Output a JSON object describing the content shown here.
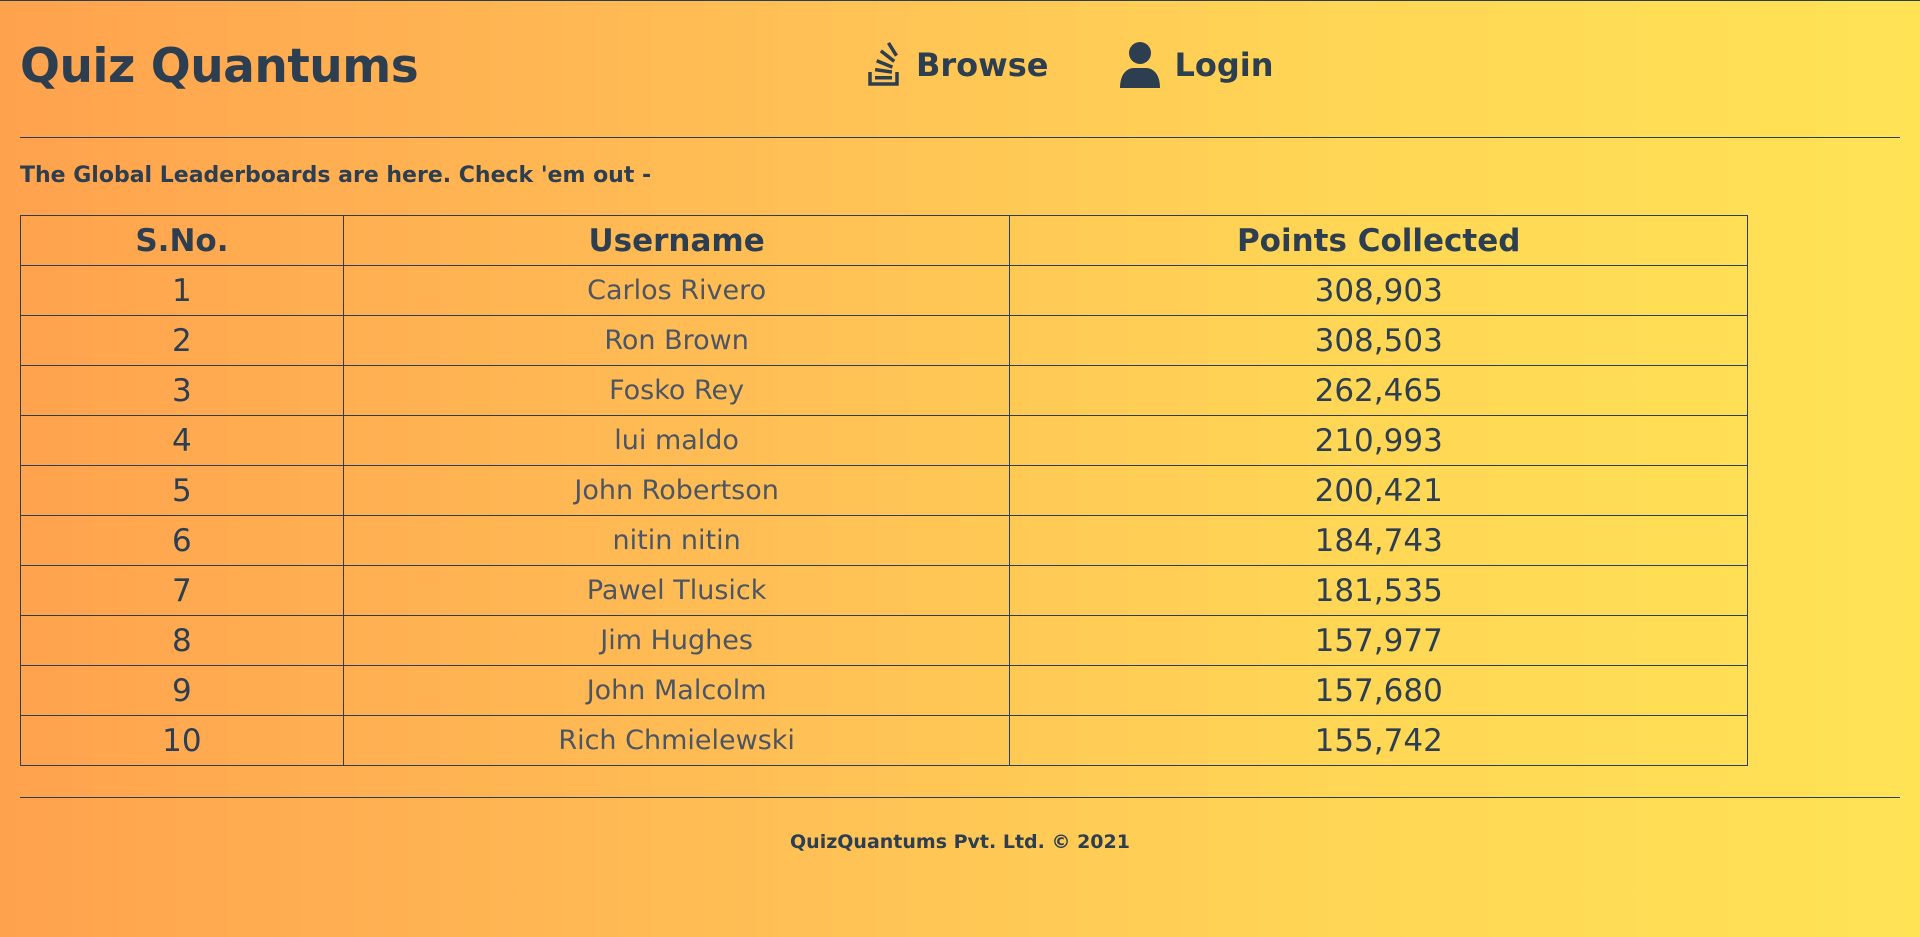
{
  "header": {
    "brand": "Quiz Quantums",
    "nav": {
      "browse_label": "Browse",
      "login_label": "Login"
    }
  },
  "main": {
    "intro": "The Global Leaderboards are here. Check 'em out -",
    "table": {
      "headers": [
        "S.No.",
        "Username",
        "Points Collected"
      ],
      "rows": [
        {
          "sno": "1",
          "username": "Carlos Rivero",
          "points": "308,903"
        },
        {
          "sno": "2",
          "username": "Ron Brown",
          "points": "308,503"
        },
        {
          "sno": "3",
          "username": "Fosko Rey",
          "points": "262,465"
        },
        {
          "sno": "4",
          "username": "lui maldo",
          "points": "210,993"
        },
        {
          "sno": "5",
          "username": "John Robertson",
          "points": "200,421"
        },
        {
          "sno": "6",
          "username": "nitin nitin",
          "points": "184,743"
        },
        {
          "sno": "7",
          "username": "Pawel Tlusick",
          "points": "181,535"
        },
        {
          "sno": "8",
          "username": "Jim Hughes",
          "points": "157,977"
        },
        {
          "sno": "9",
          "username": "John Malcolm",
          "points": "157,680"
        },
        {
          "sno": "10",
          "username": "Rich Chmielewski",
          "points": "155,742"
        }
      ]
    }
  },
  "footer": {
    "text": "QuizQuantums Pvt. Ltd. © 2021"
  },
  "icons": {
    "browse": "stack-overflow-icon",
    "login": "user-icon"
  },
  "colors": {
    "text": "#2c3e50",
    "gradient_start": "#ffa24e",
    "gradient_end": "#ffe355"
  }
}
